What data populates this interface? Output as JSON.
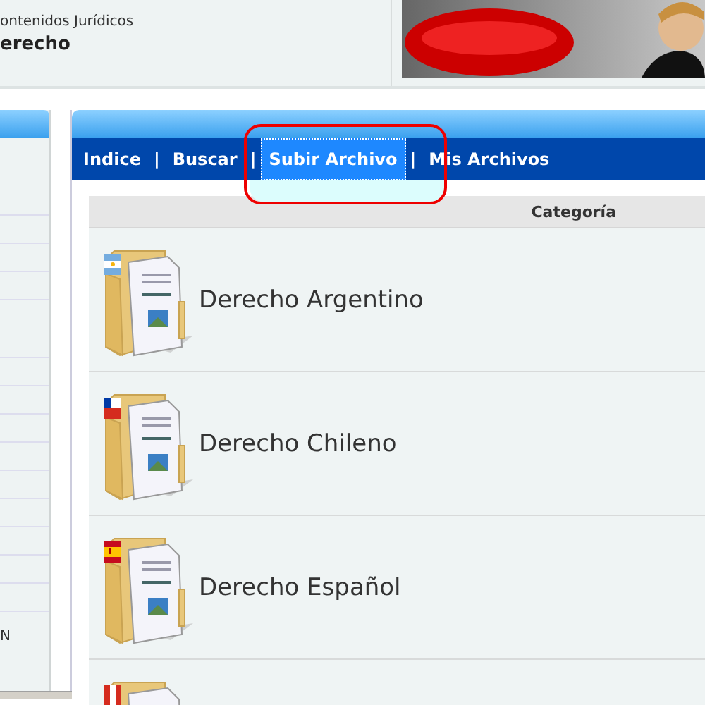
{
  "header": {
    "subtitle": "ontenidos Jurídicos",
    "title": "erecho"
  },
  "sidebar": {
    "items": [
      {
        "label": "N"
      }
    ]
  },
  "nav": [
    {
      "kind": "link",
      "label": "Indice",
      "selected": false
    },
    {
      "kind": "separator",
      "label": "|"
    },
    {
      "kind": "link",
      "label": "Buscar",
      "selected": false
    },
    {
      "kind": "separator",
      "label": "|"
    },
    {
      "kind": "link",
      "label": "Subir Archivo",
      "selected": true
    },
    {
      "kind": "separator",
      "label": "|"
    },
    {
      "kind": "link",
      "label": "Mis Archivos",
      "selected": false
    }
  ],
  "table": {
    "columns": [
      "Categoría"
    ],
    "rows": [
      {
        "name": "Derecho Argentino",
        "kind": "argentina"
      },
      {
        "name": "Derecho Chileno",
        "kind": "chile"
      },
      {
        "name": "Derecho Español",
        "kind": "spain"
      },
      {
        "kind": "red-white"
      }
    ]
  }
}
